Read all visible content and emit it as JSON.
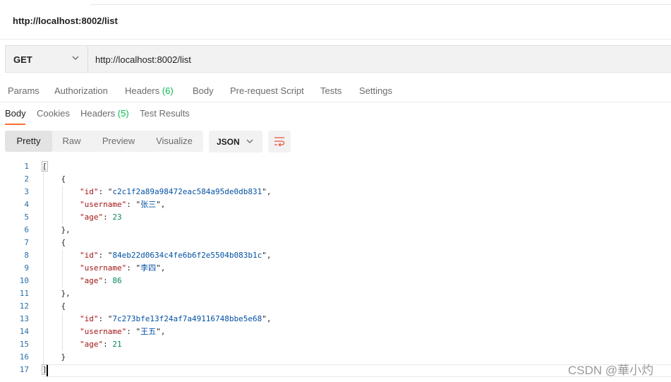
{
  "request": {
    "title": "http://localhost:8002/list",
    "method": "GET",
    "url": "http://localhost:8002/list"
  },
  "request_tabs": [
    {
      "label": "Params",
      "count": ""
    },
    {
      "label": "Authorization",
      "count": ""
    },
    {
      "label": "Headers",
      "count": "(6)"
    },
    {
      "label": "Body",
      "count": ""
    },
    {
      "label": "Pre-request Script",
      "count": ""
    },
    {
      "label": "Tests",
      "count": ""
    },
    {
      "label": "Settings",
      "count": ""
    }
  ],
  "response_tabs": [
    {
      "label": "Body",
      "count": ""
    },
    {
      "label": "Cookies",
      "count": ""
    },
    {
      "label": "Headers",
      "count": "(5)"
    },
    {
      "label": "Test Results",
      "count": ""
    }
  ],
  "view_modes": [
    "Pretty",
    "Raw",
    "Preview",
    "Visualize"
  ],
  "format": "JSON",
  "icons": {
    "method_dropdown": "chevron-down-icon",
    "format_dropdown": "chevron-down-icon",
    "wrap": "wrap-lines-icon"
  },
  "colors": {
    "accent": "#ff6c37",
    "count": "#0cbb52",
    "json_key": "#a31515",
    "json_string": "#0451a5",
    "json_number": "#098658",
    "wrap_icon": "#e8533a"
  },
  "response_body": [
    {
      "id": "c2c1f2a89a98472eac584a95de0db831",
      "username": "张三",
      "age": 23
    },
    {
      "id": "84eb22d0634c4fe6b6f2e5504b083b1c",
      "username": "李四",
      "age": 86
    },
    {
      "id": "7c273bfe13f24af7a49116748bbe5e68",
      "username": "王五",
      "age": 21
    }
  ],
  "code": {
    "line_numbers": [
      "1",
      "2",
      "3",
      "4",
      "5",
      "6",
      "7",
      "8",
      "9",
      "10",
      "11",
      "12",
      "13",
      "14",
      "15",
      "16",
      "17"
    ],
    "punct": {
      "open_array": "[",
      "close_array": "]",
      "open_obj": "{",
      "close_obj": "},",
      "close_obj_last": "}",
      "colon": ": ",
      "comma": ","
    },
    "keys": {
      "id": "\"id\"",
      "username": "\"username\"",
      "age": "\"age\""
    }
  },
  "watermark": "CSDN @華小灼"
}
